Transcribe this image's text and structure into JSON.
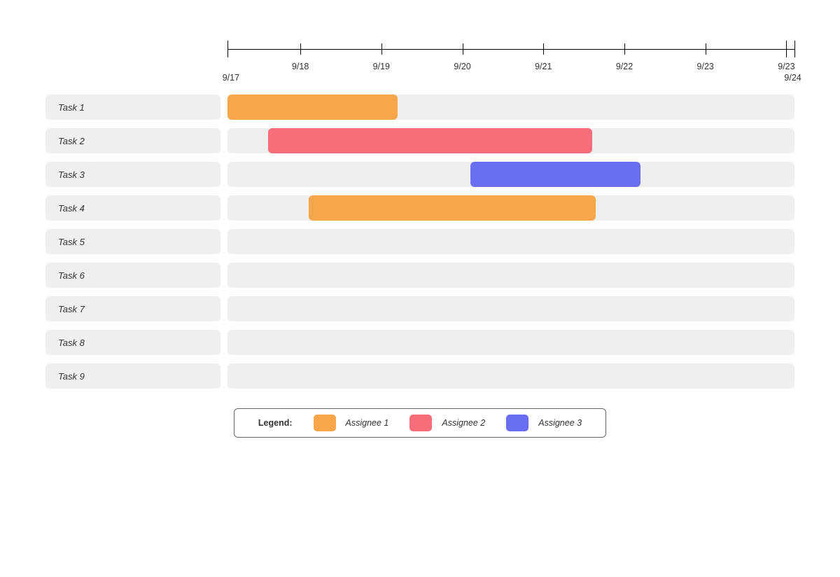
{
  "legend": {
    "title": "Legend:",
    "items": [
      {
        "name": "Assignee 1",
        "color": "#f7a64a"
      },
      {
        "name": "Assignee 2",
        "color": "#f76d7a"
      },
      {
        "name": "Assignee 3",
        "color": "#6a6ef0"
      }
    ]
  },
  "timeline": {
    "domain_start": 0,
    "domain_end": 7,
    "ticks": [
      {
        "x": 0,
        "label": "9/17",
        "label_offset": "below-left"
      },
      {
        "x": 0.9,
        "label": "9/18"
      },
      {
        "x": 1.9,
        "label": "9/19"
      },
      {
        "x": 2.9,
        "label": "9/20"
      },
      {
        "x": 3.9,
        "label": "9/21"
      },
      {
        "x": 4.9,
        "label": "9/22"
      },
      {
        "x": 5.9,
        "label": "9/23"
      },
      {
        "x": 6.9,
        "label": "9/23"
      },
      {
        "x": 7.0,
        "label": "9/24",
        "label_offset": "below-right"
      }
    ]
  },
  "tasks": [
    {
      "name": "Task 1"
    },
    {
      "name": "Task 2"
    },
    {
      "name": "Task 3"
    },
    {
      "name": "Task 4"
    },
    {
      "name": "Task 5"
    },
    {
      "name": "Task 6"
    },
    {
      "name": "Task 7"
    },
    {
      "name": "Task 8"
    },
    {
      "name": "Task 9"
    }
  ],
  "chart_data": {
    "type": "gantt",
    "x_unit": "date",
    "x_domain": [
      "9/17",
      "9/24"
    ],
    "axis_ticks": [
      "9/17",
      "9/18",
      "9/19",
      "9/20",
      "9/21",
      "9/22",
      "9/23",
      "9/23",
      "9/24"
    ],
    "categories": [
      "Task 1",
      "Task 2",
      "Task 3",
      "Task 4",
      "Task 5",
      "Task 6",
      "Task 7",
      "Task 8",
      "Task 9"
    ],
    "assignees": [
      "Assignee 1",
      "Assignee 2",
      "Assignee 3"
    ],
    "colors": {
      "Assignee 1": "#f7a64a",
      "Assignee 2": "#f76d7a",
      "Assignee 3": "#6a6ef0"
    },
    "bars": [
      {
        "task": "Task 1",
        "assignee": "Assignee 1",
        "start_x": 0.0,
        "end_x": 2.1
      },
      {
        "task": "Task 2",
        "assignee": "Assignee 2",
        "start_x": 0.5,
        "end_x": 4.5
      },
      {
        "task": "Task 3",
        "assignee": "Assignee 3",
        "start_x": 3.0,
        "end_x": 5.1
      },
      {
        "task": "Task 4",
        "assignee": "Assignee 1",
        "start_x": 1.0,
        "end_x": 4.55
      }
    ],
    "note": "start_x/end_x are in axis units where 0 = 9/17 and 7 = 9/24; values read from figure."
  }
}
